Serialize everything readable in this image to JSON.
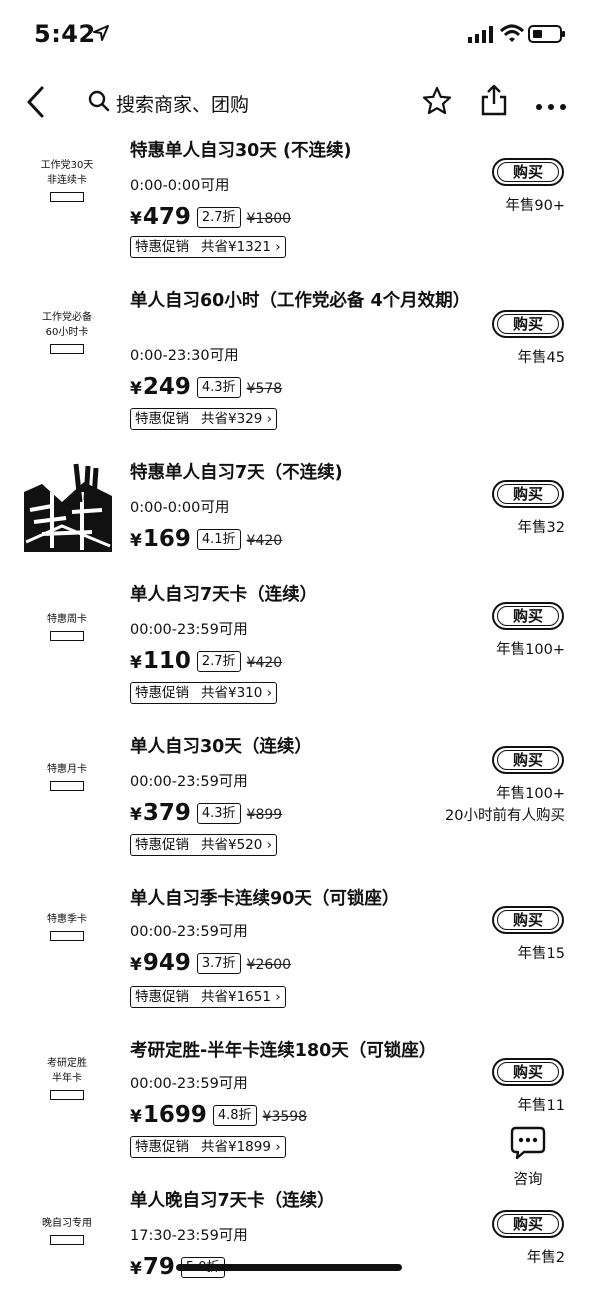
{
  "status_bar": {
    "time": "5:42"
  },
  "search": {
    "placeholder": "搜索商家、团购"
  },
  "items": [
    {
      "thumb_lines": [
        "工作党30天",
        "非连续卡"
      ],
      "title": "特惠单人自习30天 (不连续)",
      "hours": "0:00-0:00可用",
      "price": "479",
      "discount": "2.7折",
      "original": "¥1800",
      "promo_label": "特惠促销",
      "promo_save": "共省¥1321",
      "buy": "购买",
      "sales": "年售90+"
    },
    {
      "thumb_lines": [
        "工作党必备",
        "60小时卡"
      ],
      "title": "单人自习60小时（工作党必备 4个月效期）",
      "hours": "0:00-23:30可用",
      "price": "249",
      "discount": "4.3折",
      "original": "¥578",
      "promo_label": "特惠促销",
      "promo_save": "共省¥329",
      "buy": "购买",
      "sales": "年售45"
    },
    {
      "title": "特惠单人自习7天（不连续)",
      "hours": "0:00-0:00可用",
      "price": "169",
      "discount": "4.1折",
      "original": "¥420",
      "buy": "购买",
      "sales": "年售32"
    },
    {
      "thumb_lines": [
        "特惠周卡"
      ],
      "title": "单人自习7天卡（连续）",
      "hours": "00:00-23:59可用",
      "price": "110",
      "discount": "2.7折",
      "original": "¥420",
      "promo_label": "特惠促销",
      "promo_save": "共省¥310",
      "buy": "购买",
      "sales": "年售100+"
    },
    {
      "thumb_lines": [
        "特惠月卡"
      ],
      "title": "单人自习30天（连续）",
      "hours": "00:00-23:59可用",
      "price": "379",
      "discount": "4.3折",
      "original": "¥899",
      "promo_label": "特惠促销",
      "promo_save": "共省¥520",
      "buy": "购买",
      "sales": "年售100+",
      "recent": "20小时前有人购买"
    },
    {
      "thumb_lines": [
        "特惠季卡"
      ],
      "title": "单人自习季卡连续90天（可锁座）",
      "hours": "00:00-23:59可用",
      "price": "949",
      "discount": "3.7折",
      "original": "¥2600",
      "promo_label": "特惠促销",
      "promo_save": "共省¥1651",
      "buy": "购买",
      "sales": "年售15"
    },
    {
      "thumb_lines": [
        "考研定胜",
        "半年卡"
      ],
      "title": "考研定胜-半年卡连续180天（可锁座）",
      "hours": "00:00-23:59可用",
      "price": "1699",
      "discount": "4.8折",
      "original": "¥3598",
      "promo_label": "特惠促销",
      "promo_save": "共省¥1899",
      "buy": "购买",
      "sales": "年售11"
    },
    {
      "thumb_lines": [
        "晚自习专用"
      ],
      "title": "单人晚自习7天卡（连续）",
      "hours": "17:30-23:59可用",
      "price": "79",
      "discount": "5.0折",
      "buy": "购买",
      "sales": "年售2"
    }
  ],
  "currency": "¥",
  "consult": {
    "label": "咨询"
  },
  "icons": [
    "location-arrow-icon",
    "signal-icon",
    "wifi-icon",
    "battery-icon",
    "back-chevron-icon",
    "search-icon",
    "star-icon",
    "share-icon",
    "more-icon",
    "chat-icon"
  ]
}
